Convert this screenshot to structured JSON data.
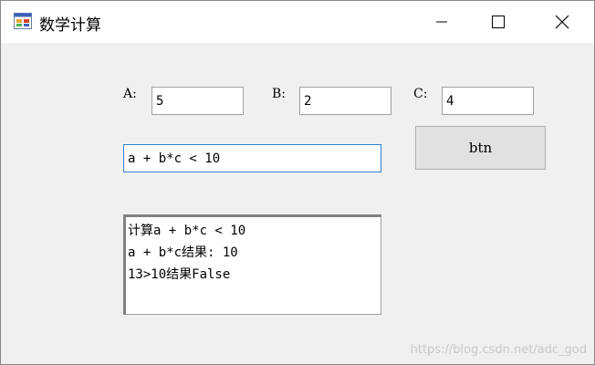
{
  "window": {
    "title": "数学计算",
    "icon": "app-form-icon",
    "controls": {
      "minimize": "minimize-icon",
      "maximize": "maximize-icon",
      "close": "close-icon"
    }
  },
  "form": {
    "label_a": "A:",
    "value_a": "5",
    "label_b": "B:",
    "value_b": "2",
    "label_c": "C:",
    "value_c": "4",
    "expression": "a + b*c < 10",
    "button_label": "btn",
    "output_lines": [
      "计算a + b*c < 10",
      "a + b*c结果: 10",
      "13>10结果False"
    ]
  },
  "watermark": "https://blog.csdn.net/adc_god",
  "colors": {
    "window_bg": "#f0f0f0",
    "titlebar_bg": "#ffffff",
    "focus_border": "#2f7fd0",
    "button_bg": "#e1e1e1"
  }
}
